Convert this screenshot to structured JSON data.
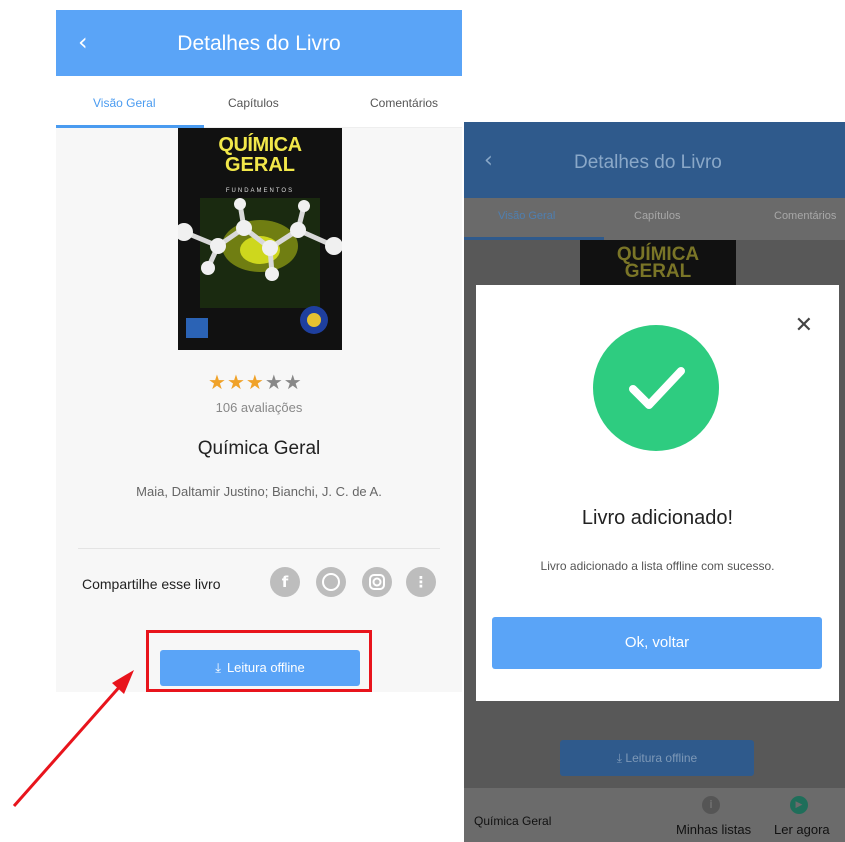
{
  "left": {
    "header": {
      "back_icon": "‹",
      "title": "Detalhes do Livro"
    },
    "tabs": [
      {
        "label": "Visão Geral"
      },
      {
        "label": "Capítulos"
      },
      {
        "label": "Comentários"
      }
    ],
    "book": {
      "cover_line1": "QUÍMICA",
      "cover_line2": "GERAL",
      "cover_line3": "FUNDAMENTOS",
      "rating": 3,
      "rating_max": 5,
      "reviews": "106 avaliações",
      "title": "Química Geral",
      "authors": "Maia, Daltamir Justino; Bianchi, J. C. de A."
    },
    "share": {
      "label": "Compartilhe esse livro"
    },
    "offline_button": {
      "icon": "⤓",
      "label": "Leitura offline"
    }
  },
  "right": {
    "header": {
      "back_icon": "‹",
      "title": "Detalhes do Livro"
    },
    "tabs": [
      {
        "label": "Visão Geral"
      },
      {
        "label": "Capítulos"
      },
      {
        "label": "Comentários"
      }
    ],
    "cover_line1": "QUÍMICA",
    "cover_line2": "GERAL",
    "offline_button": {
      "label": "⤓  Leitura offline"
    },
    "bottom_bar": {
      "book_title": "Química Geral",
      "lists_label": "Minhas listas",
      "read_label": "Ler agora"
    },
    "modal": {
      "close_icon": "✕",
      "title": "Livro adicionado!",
      "message": "Livro adicionado a lista offline com sucesso.",
      "ok_label": "Ok, voltar"
    }
  },
  "colors": {
    "primary": "#5aa4f7",
    "success": "#2ecc80",
    "annotation": "#e8141c",
    "star": "#f0a229"
  }
}
